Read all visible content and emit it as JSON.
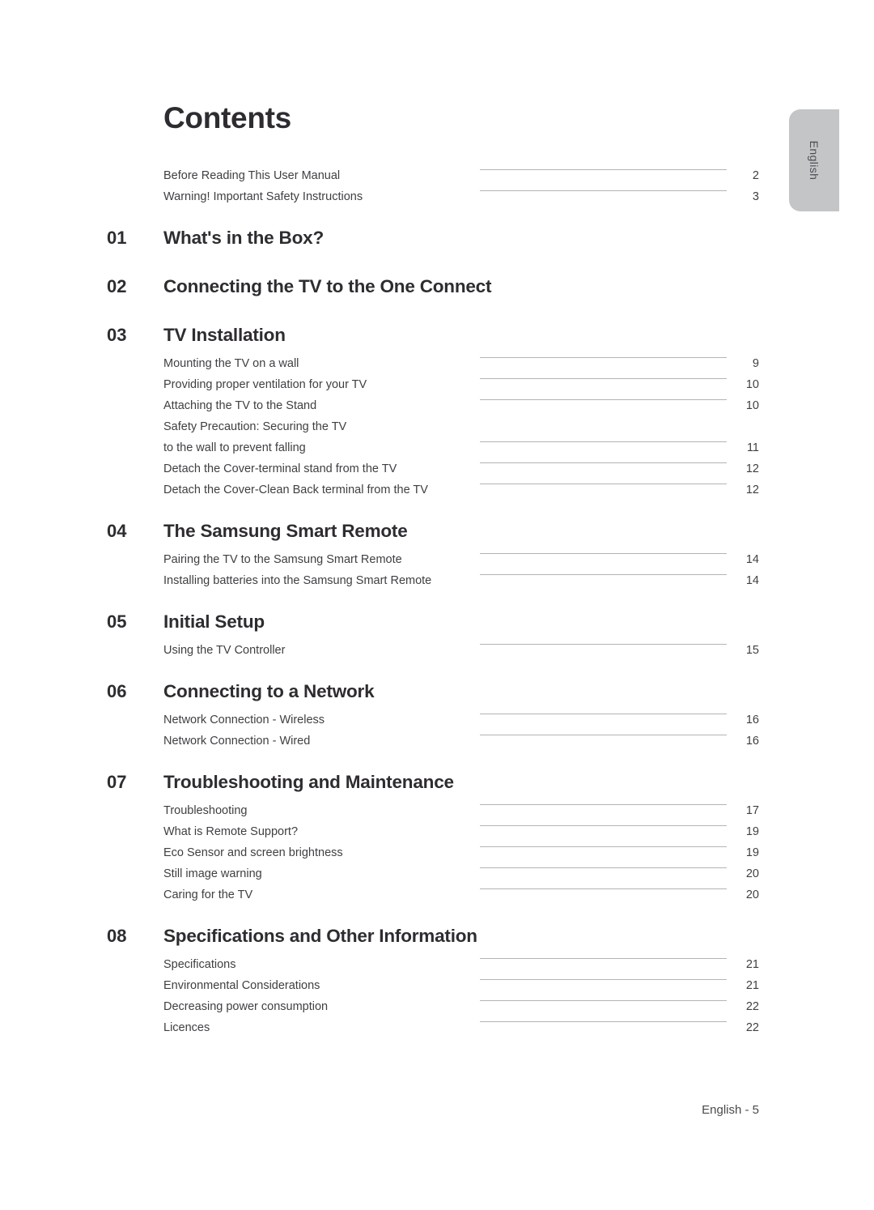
{
  "page": {
    "title": "Contents",
    "footer": "English - 5",
    "side_tab_label": "English",
    "side_tab_color": "#c3c5c7",
    "text_color": "#3b3b3f",
    "heading_color": "#2f2c31",
    "leader_color": "#b4b4b8"
  },
  "preface": [
    {
      "label": "Before Reading This User Manual",
      "page": "2"
    },
    {
      "label": "Warning! Important Safety Instructions",
      "page": "3"
    }
  ],
  "chapters": [
    {
      "num": "01",
      "title": "What's in the Box?",
      "items": []
    },
    {
      "num": "02",
      "title": "Connecting the TV to the One Connect",
      "items": []
    },
    {
      "num": "03",
      "title": "TV Installation",
      "items": [
        {
          "label": "Mounting the TV on a wall",
          "page": "9"
        },
        {
          "label": "Providing proper ventilation for your TV",
          "page": "10"
        },
        {
          "label": "Attaching the TV to the Stand",
          "page": "10"
        },
        {
          "label": "Safety Precaution: Securing the TV",
          "page": ""
        },
        {
          "label": "to the wall to prevent falling",
          "page": "11"
        },
        {
          "label": "Detach the Cover-terminal stand from the TV",
          "page": "12"
        },
        {
          "label": "Detach the Cover-Clean Back terminal from the TV",
          "page": "12"
        }
      ]
    },
    {
      "num": "04",
      "title": "The Samsung Smart Remote",
      "items": [
        {
          "label": "Pairing the TV to the Samsung Smart Remote",
          "page": "14"
        },
        {
          "label": "Installing batteries into the Samsung Smart Remote",
          "page": "14"
        }
      ]
    },
    {
      "num": "05",
      "title": "Initial Setup",
      "items": [
        {
          "label": "Using the TV Controller",
          "page": "15"
        }
      ]
    },
    {
      "num": "06",
      "title": "Connecting to a Network",
      "items": [
        {
          "label": "Network Connection - Wireless",
          "page": "16"
        },
        {
          "label": "Network Connection - Wired",
          "page": "16"
        }
      ]
    },
    {
      "num": "07",
      "title": "Troubleshooting and Maintenance",
      "items": [
        {
          "label": "Troubleshooting",
          "page": "17"
        },
        {
          "label": "What is Remote Support?",
          "page": "19"
        },
        {
          "label": "Eco Sensor and screen brightness",
          "page": "19"
        },
        {
          "label": "Still image warning",
          "page": "20"
        },
        {
          "label": "Caring for the TV",
          "page": "20"
        }
      ]
    },
    {
      "num": "08",
      "title": "Specifications and Other Information",
      "items": [
        {
          "label": "Specifications",
          "page": "21"
        },
        {
          "label": "Environmental Considerations",
          "page": "21"
        },
        {
          "label": "Decreasing power consumption",
          "page": "22"
        },
        {
          "label": "Licences",
          "page": "22"
        }
      ]
    }
  ]
}
